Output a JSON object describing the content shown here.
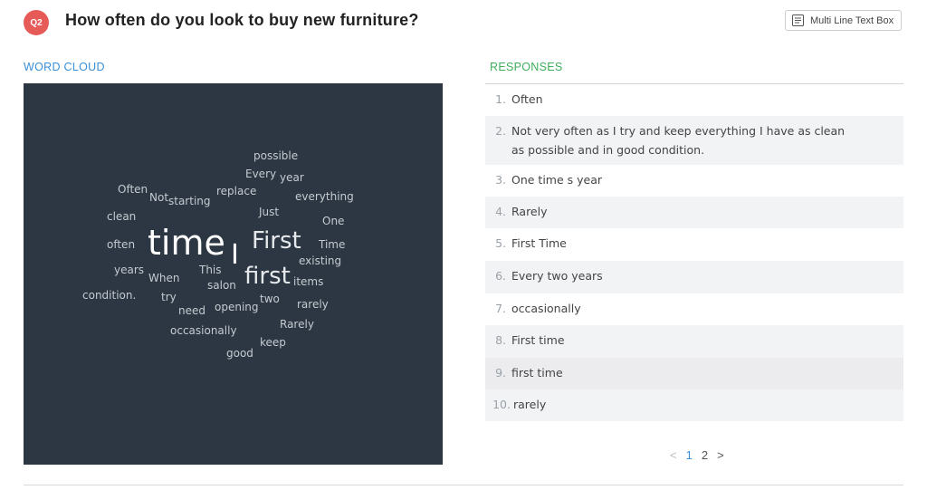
{
  "question": {
    "badge": "Q2",
    "title": "How often do you look to buy new furniture?",
    "type_label": "Multi Line Text Box",
    "type_icon": "text-lines-icon"
  },
  "word_cloud": {
    "heading": "WORD CLOUD",
    "background": "#2c3743",
    "words": [
      "possible",
      "Every",
      "year",
      "Often",
      "Not",
      "starting",
      "replace",
      "everything",
      "clean",
      "Just",
      "One",
      "time",
      "I",
      "First",
      "Time",
      "often",
      "existing",
      "years",
      "This",
      "first",
      "When",
      "items",
      "salon",
      "condition.",
      "two",
      "try",
      "rarely",
      "opening",
      "need",
      "Rarely",
      "occasionally",
      "keep",
      "good"
    ]
  },
  "responses": {
    "heading": "RESPONSES",
    "items": [
      {
        "num": "1.",
        "text": "Often"
      },
      {
        "num": "2.",
        "text": "Not very often as I try and keep everything I have as clean as possible and in good condition."
      },
      {
        "num": "3.",
        "text": "One time s year"
      },
      {
        "num": "4.",
        "text": "Rarely"
      },
      {
        "num": "5.",
        "text": "First Time"
      },
      {
        "num": "6.",
        "text": "Every two years"
      },
      {
        "num": "7.",
        "text": "occasionally"
      },
      {
        "num": "8.",
        "text": "First time"
      },
      {
        "num": "9.",
        "text": "first time"
      },
      {
        "num": "10.",
        "text": "rarely"
      }
    ]
  },
  "pagination": {
    "prev": "<",
    "pages": [
      "1",
      "2"
    ],
    "current": "1",
    "next": ">"
  },
  "colors": {
    "badge": "#e65a58",
    "word_cloud_heading": "#3a8fd6",
    "responses_heading": "#3fae5c",
    "current_page": "#3a8fd6"
  }
}
